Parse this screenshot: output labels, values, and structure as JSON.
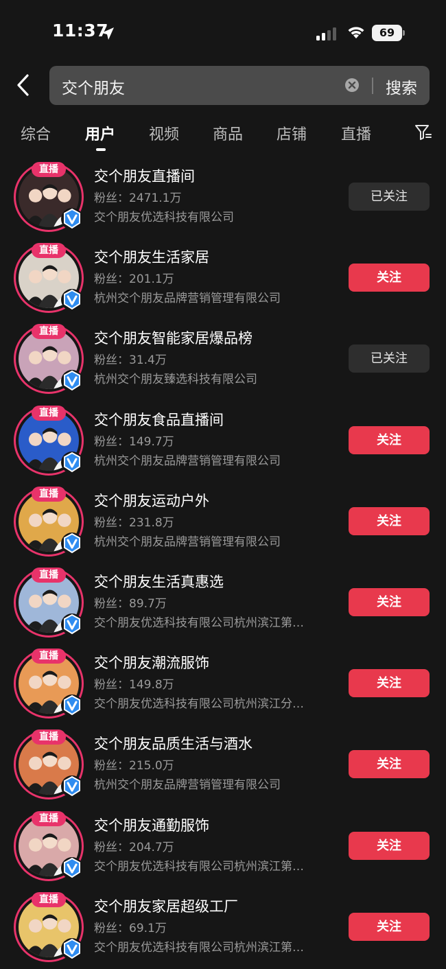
{
  "status_bar": {
    "time": "11:37",
    "battery": "69"
  },
  "search": {
    "value": "交个朋友",
    "button_label": "搜索"
  },
  "tabs": [
    {
      "label": "综合"
    },
    {
      "label": "用户"
    },
    {
      "label": "视频"
    },
    {
      "label": "商品"
    },
    {
      "label": "店铺"
    },
    {
      "label": "直播"
    }
  ],
  "active_tab": "用户",
  "live_label": "直播",
  "results": [
    {
      "name": "交个朋友直播间",
      "fans": "粉丝：2471.1万",
      "company": "交个朋友优选科技有限公司",
      "button": "已关注",
      "followed": true,
      "bg": "#3a2a2a"
    },
    {
      "name": "交个朋友生活家居",
      "fans": "粉丝：201.1万",
      "company": "杭州交个朋友品牌营销管理有限公司",
      "button": "关注",
      "followed": false,
      "bg": "#d9d2c8"
    },
    {
      "name": "交个朋友智能家居爆品榜",
      "fans": "粉丝：31.4万",
      "company": "杭州交个朋友臻选科技有限公司",
      "button": "已关注",
      "followed": true,
      "bg": "#c9a3b8"
    },
    {
      "name": "交个朋友食品直播间",
      "fans": "粉丝：149.7万",
      "company": "杭州交个朋友品牌营销管理有限公司",
      "button": "关注",
      "followed": false,
      "bg": "#2a5cc9"
    },
    {
      "name": "交个朋友运动户外",
      "fans": "粉丝：231.8万",
      "company": "杭州交个朋友品牌营销管理有限公司",
      "button": "关注",
      "followed": false,
      "bg": "#e0a84a"
    },
    {
      "name": "交个朋友生活真惠选",
      "fans": "粉丝：89.7万",
      "company": "交个朋友优选科技有限公司杭州滨江第…",
      "button": "关注",
      "followed": false,
      "bg": "#9fb7d9"
    },
    {
      "name": "交个朋友潮流服饰",
      "fans": "粉丝：149.8万",
      "company": "交个朋友优选科技有限公司杭州滨江分…",
      "button": "关注",
      "followed": false,
      "bg": "#e89a56"
    },
    {
      "name": "交个朋友品质生活与酒水",
      "fans": "粉丝：215.0万",
      "company": "杭州交个朋友品牌营销管理有限公司",
      "button": "关注",
      "followed": false,
      "bg": "#d97a4a"
    },
    {
      "name": "交个朋友通勤服饰",
      "fans": "粉丝：204.7万",
      "company": "交个朋友优选科技有限公司杭州滨江第…",
      "button": "关注",
      "followed": false,
      "bg": "#d9a9a9"
    },
    {
      "name": "交个朋友家居超级工厂",
      "fans": "粉丝：69.1万",
      "company": "交个朋友优选科技有限公司杭州滨江第…",
      "button": "关注",
      "followed": false,
      "bg": "#e8c46a"
    }
  ]
}
